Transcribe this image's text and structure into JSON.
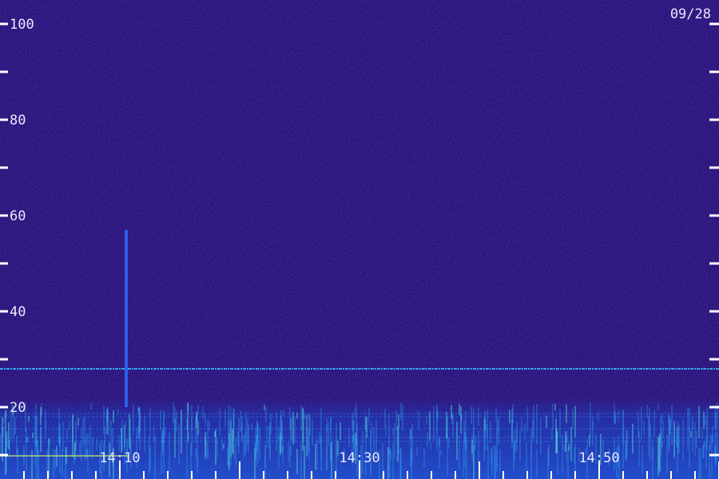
{
  "chart_data": {
    "type": "heatmap",
    "title": "",
    "xlabel": "",
    "ylabel": "",
    "date_label": "09/28",
    "y_ticks": [
      20,
      40,
      60,
      80,
      100
    ],
    "x_ticks": [
      "14:10",
      "14:30",
      "14:50"
    ],
    "ylim": [
      0,
      100
    ],
    "xlim": [
      "14:02",
      "14:62"
    ],
    "grid": false,
    "colors": {
      "background": "#241070",
      "noise_dark": "#14084a",
      "noise_light": "#3a24c0",
      "low_band": "#1b3fc4",
      "line": "#35c0ff",
      "hot": "#5cf0d8",
      "text": "#e8e8ff",
      "tick": "#ffffff"
    },
    "features": {
      "horizontal_line_value": 28,
      "vertical_burst": {
        "time": "14:12",
        "y_from": 20,
        "y_to": 57
      }
    }
  }
}
